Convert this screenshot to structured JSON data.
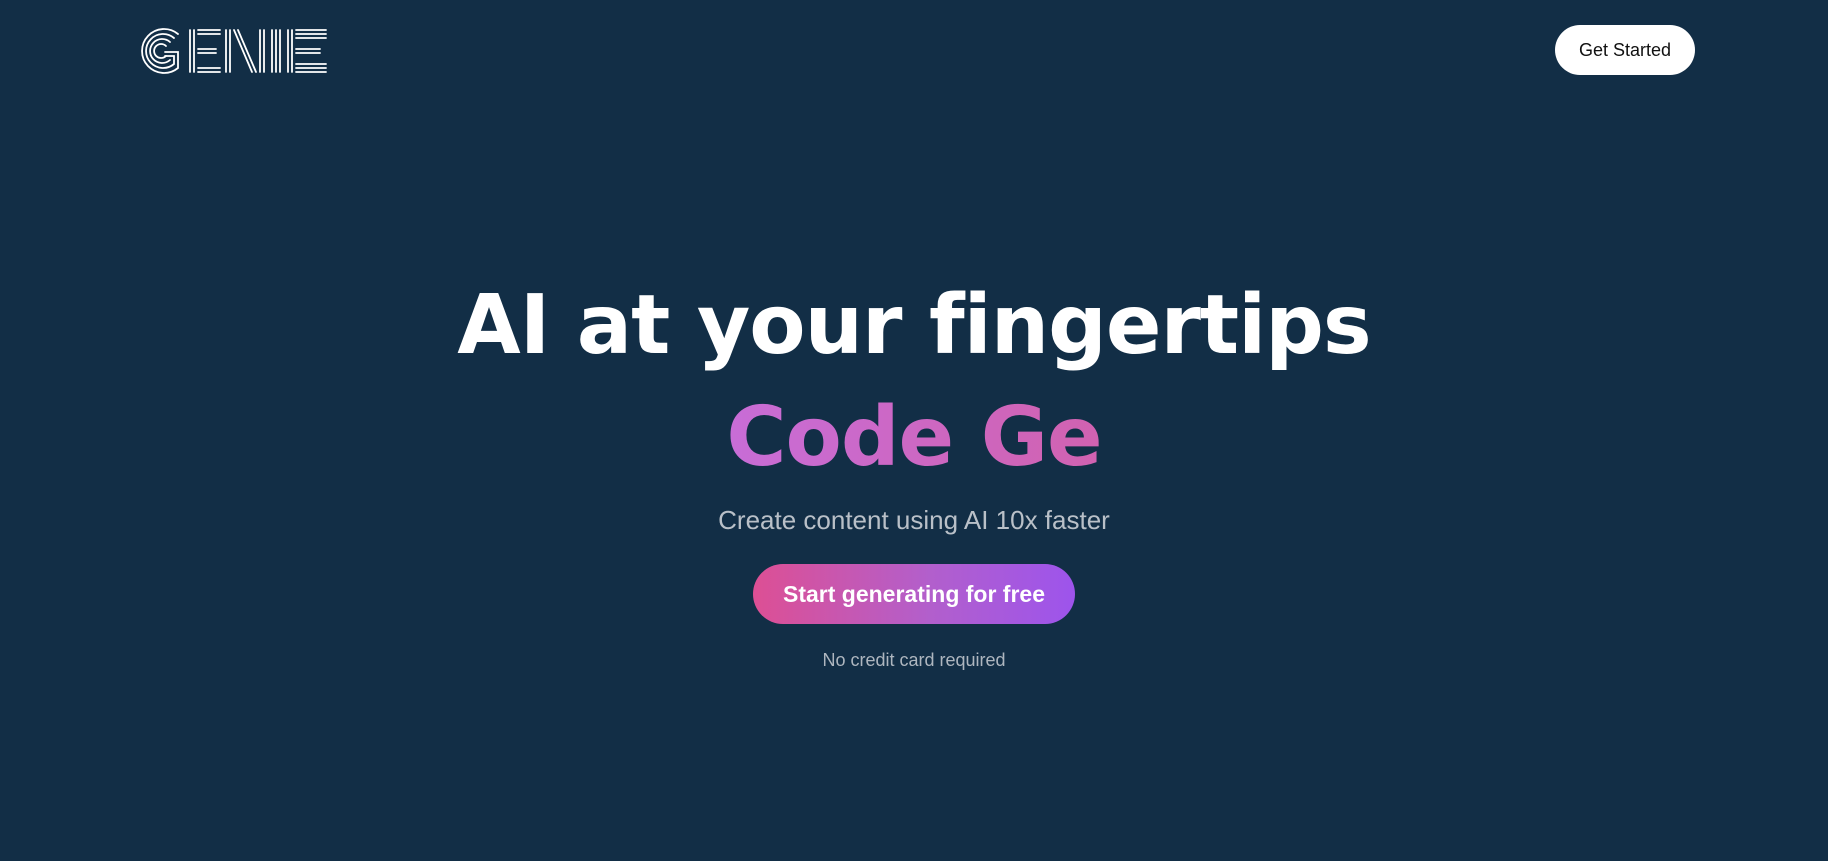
{
  "brand": {
    "logo_text": "GENIE",
    "logo_icon": "genie-logo-icon"
  },
  "nav": {
    "get_started_label": "Get Started"
  },
  "hero": {
    "headline": "AI at your fingertips",
    "typed_text": "Code Ge",
    "subtitle": "Create content using AI 10x faster",
    "cta_label": "Start generating for free",
    "note": "No credit card required"
  },
  "colors": {
    "background": "#122e46",
    "typed_gradient_start": "#c86dd7",
    "typed_gradient_end": "#d162b0",
    "cta_gradient_start": "#dd4f94",
    "cta_gradient_end": "#9d54ec"
  }
}
